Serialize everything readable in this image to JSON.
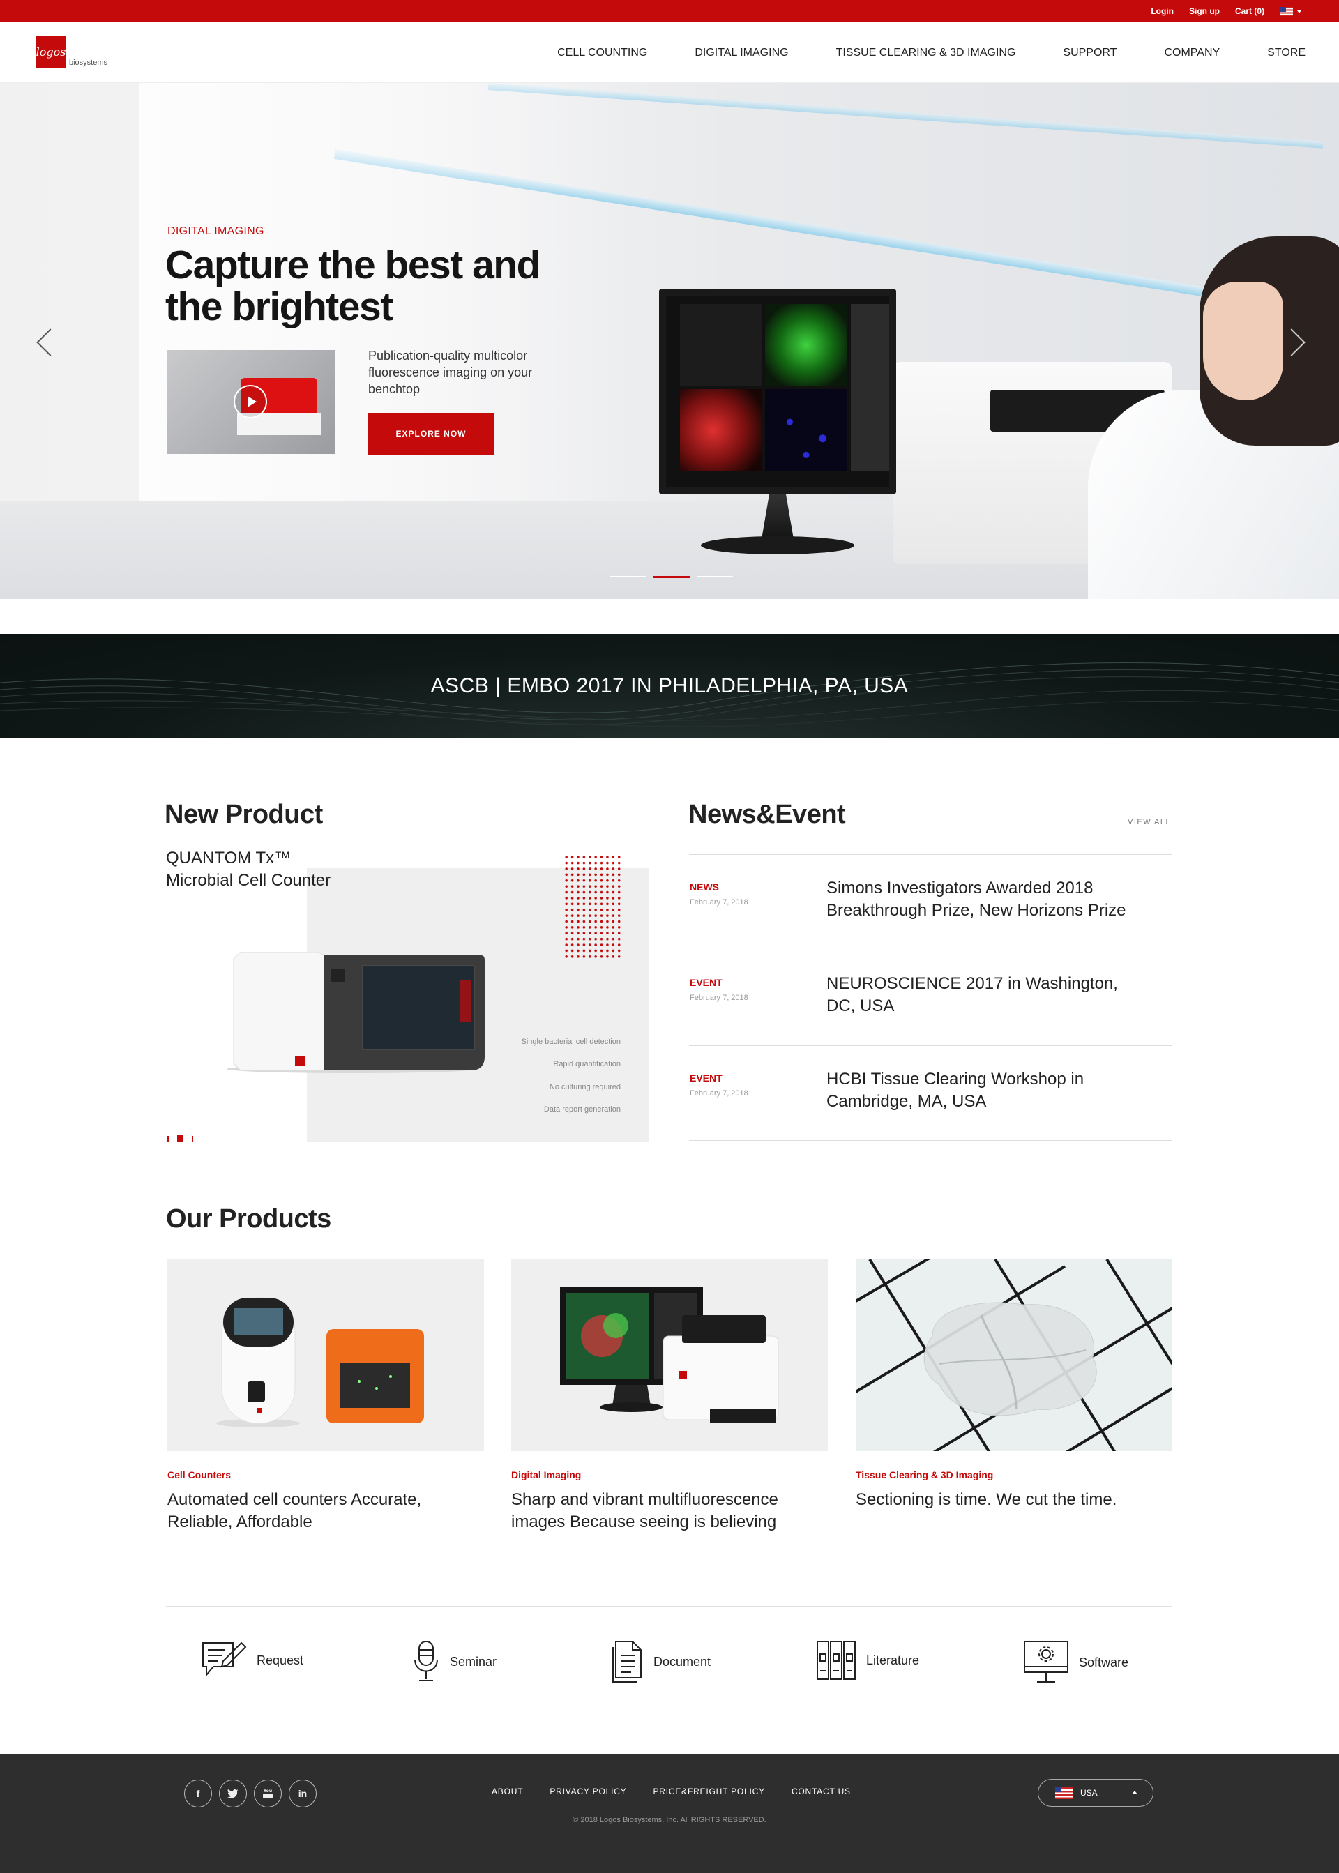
{
  "topbar": {
    "login": "Login",
    "signup": "Sign up",
    "cart": "Cart (0)"
  },
  "logo": {
    "mark": "logos",
    "text": "biosystems"
  },
  "nav": [
    "CELL COUNTING",
    "DIGITAL IMAGING",
    "TISSUE CLEARING & 3D IMAGING",
    "SUPPORT",
    "COMPANY",
    "STORE"
  ],
  "hero": {
    "category": "DIGITAL IMAGING",
    "title": "Capture the best and the brightest",
    "description": "Publication-quality multicolor fluorescence imaging on your benchtop",
    "button": "EXPLORE NOW",
    "slide_count": 3,
    "active_slide": 2
  },
  "banner": {
    "text": "ASCB | EMBO 2017 IN PHILADELPHIA, PA, USA"
  },
  "new_product": {
    "heading": "New Product",
    "name_line1": "QUANTOM Tx™",
    "name_line2": "Microbial Cell Counter",
    "features": [
      "Single bacterial cell detection",
      "Rapid quantification",
      "No culturing required",
      "Data report generation"
    ],
    "slide_count": 3,
    "active_slide": 2
  },
  "news": {
    "heading": "News&Event",
    "view_all": "VIEW ALL",
    "items": [
      {
        "tag": "NEWS",
        "date": "February 7, 2018",
        "title": "Simons Investigators Awarded 2018 Breakthrough Prize, New Horizons Prize"
      },
      {
        "tag": "EVENT",
        "date": "February 7, 2018",
        "title": "NEUROSCIENCE 2017 in Washington, DC, USA"
      },
      {
        "tag": "EVENT",
        "date": "February 7, 2018",
        "title": "HCBI Tissue Clearing Workshop in Cambridge, MA, USA"
      }
    ]
  },
  "products": {
    "heading": "Our Products",
    "items": [
      {
        "category": "Cell Counters",
        "description": "Automated cell counters Accurate, Reliable, Affordable"
      },
      {
        "category": "Digital Imaging",
        "description": "Sharp and vibrant multifluorescence images Because seeing is believing"
      },
      {
        "category": "Tissue Clearing & 3D Imaging",
        "description": "Sectioning is time. We cut the time."
      }
    ]
  },
  "resources": [
    {
      "label": "Request",
      "icon": "request-icon"
    },
    {
      "label": "Seminar",
      "icon": "microphone-icon"
    },
    {
      "label": "Document",
      "icon": "document-icon"
    },
    {
      "label": "Literature",
      "icon": "literature-icon"
    },
    {
      "label": "Software",
      "icon": "software-icon"
    }
  ],
  "footer": {
    "social": [
      "f",
      "t",
      "yt",
      "in"
    ],
    "links": [
      "ABOUT",
      "PRIVACY POLICY",
      "PRICE&FREIGHT POLICY",
      "CONTACT US"
    ],
    "copyright": "© 2018 Logos Biosystems, Inc. All RIGHTS RESERVED.",
    "country": "USA"
  },
  "colors": {
    "brand_red": "#c40a0a",
    "footer_bg": "#2e2e2e",
    "banner_bg": "#0f1817"
  }
}
